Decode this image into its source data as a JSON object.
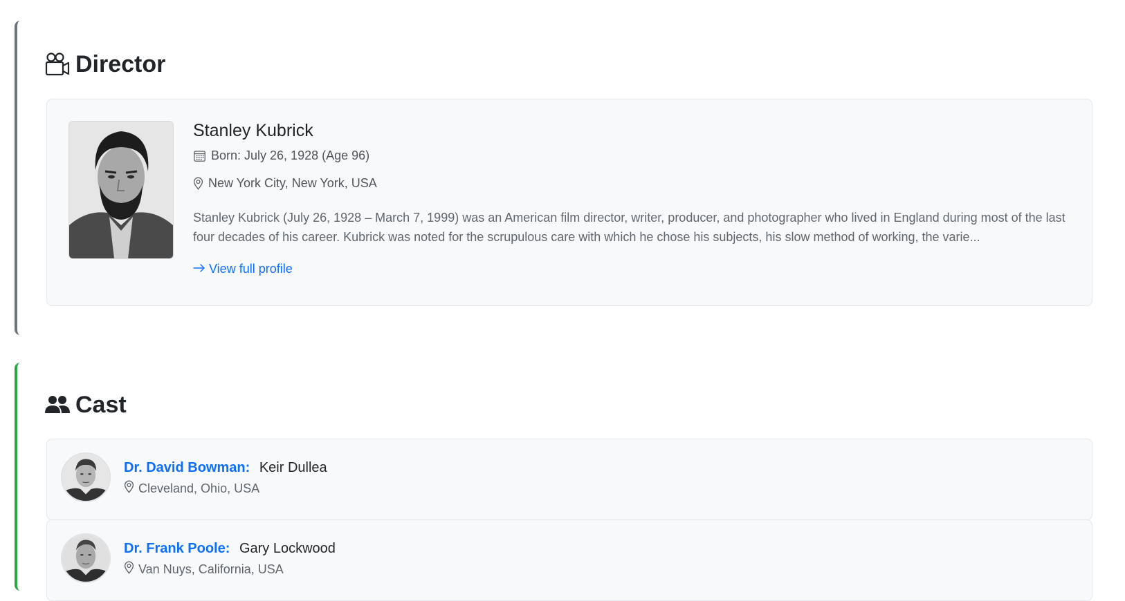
{
  "director_section": {
    "title": "Director",
    "icon": "film-camera-icon",
    "accent_color": "#6c757d",
    "person": {
      "name": "Stanley Kubrick",
      "born": "Born: July 26, 1928 (Age 96)",
      "birthplace": "New York City, New York, USA",
      "bio": "Stanley Kubrick (July 26, 1928 – March 7, 1999) was an American film director, writer, producer, and photographer who lived in England during most of the last four decades of his career. Kubrick was noted for the scrupulous care with which he chose his subjects, his slow method of working, the varie...",
      "profile_link": "View full profile"
    }
  },
  "cast_section": {
    "title": "Cast",
    "icon": "people-icon",
    "accent_color": "#28a745",
    "members": [
      {
        "role": "Dr. David Bowman:",
        "actor": "Keir Dullea",
        "place": "Cleveland, Ohio, USA"
      },
      {
        "role": "Dr. Frank Poole:",
        "actor": "Gary Lockwood",
        "place": "Van Nuys, California, USA"
      }
    ]
  },
  "colors": {
    "link": "#0d6efd",
    "card_bg": "#f8f9fa",
    "text_muted": "#5f666d"
  }
}
